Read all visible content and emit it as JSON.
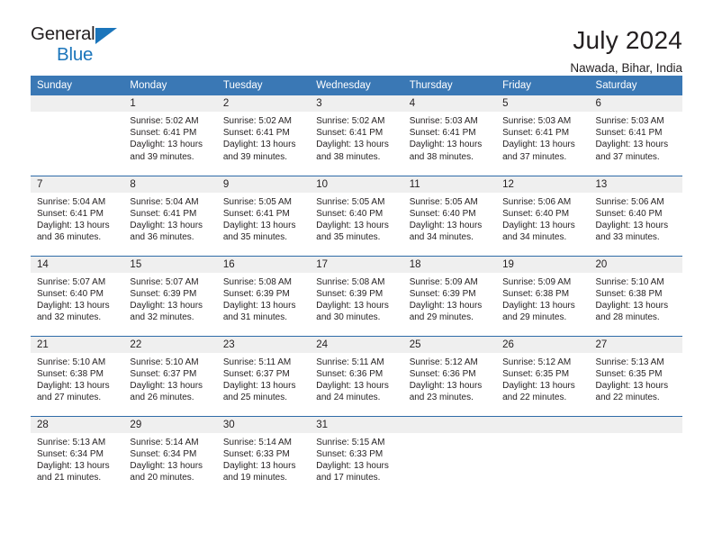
{
  "brand": {
    "name_part1": "General",
    "name_part2": "Blue"
  },
  "header": {
    "month_year": "July 2024",
    "location": "Nawada, Bihar, India"
  },
  "theme": {
    "header_blue": "#3a78b5",
    "rule_blue": "#2f6ca8",
    "daynum_gray": "#efefef",
    "logo_blue": "#1b75bb",
    "text_dark": "#231f20"
  },
  "weekday_headers": [
    "Sunday",
    "Monday",
    "Tuesday",
    "Wednesday",
    "Thursday",
    "Friday",
    "Saturday"
  ],
  "weeks": [
    [
      {
        "day": "",
        "blank": true,
        "sunrise": "",
        "sunset": "",
        "daylight_1": "",
        "daylight_2": ""
      },
      {
        "day": "1",
        "blank": false,
        "sunrise": "Sunrise: 5:02 AM",
        "sunset": "Sunset: 6:41 PM",
        "daylight_1": "Daylight: 13 hours",
        "daylight_2": "and 39 minutes."
      },
      {
        "day": "2",
        "blank": false,
        "sunrise": "Sunrise: 5:02 AM",
        "sunset": "Sunset: 6:41 PM",
        "daylight_1": "Daylight: 13 hours",
        "daylight_2": "and 39 minutes."
      },
      {
        "day": "3",
        "blank": false,
        "sunrise": "Sunrise: 5:02 AM",
        "sunset": "Sunset: 6:41 PM",
        "daylight_1": "Daylight: 13 hours",
        "daylight_2": "and 38 minutes."
      },
      {
        "day": "4",
        "blank": false,
        "sunrise": "Sunrise: 5:03 AM",
        "sunset": "Sunset: 6:41 PM",
        "daylight_1": "Daylight: 13 hours",
        "daylight_2": "and 38 minutes."
      },
      {
        "day": "5",
        "blank": false,
        "sunrise": "Sunrise: 5:03 AM",
        "sunset": "Sunset: 6:41 PM",
        "daylight_1": "Daylight: 13 hours",
        "daylight_2": "and 37 minutes."
      },
      {
        "day": "6",
        "blank": false,
        "sunrise": "Sunrise: 5:03 AM",
        "sunset": "Sunset: 6:41 PM",
        "daylight_1": "Daylight: 13 hours",
        "daylight_2": "and 37 minutes."
      }
    ],
    [
      {
        "day": "7",
        "blank": false,
        "sunrise": "Sunrise: 5:04 AM",
        "sunset": "Sunset: 6:41 PM",
        "daylight_1": "Daylight: 13 hours",
        "daylight_2": "and 36 minutes."
      },
      {
        "day": "8",
        "blank": false,
        "sunrise": "Sunrise: 5:04 AM",
        "sunset": "Sunset: 6:41 PM",
        "daylight_1": "Daylight: 13 hours",
        "daylight_2": "and 36 minutes."
      },
      {
        "day": "9",
        "blank": false,
        "sunrise": "Sunrise: 5:05 AM",
        "sunset": "Sunset: 6:41 PM",
        "daylight_1": "Daylight: 13 hours",
        "daylight_2": "and 35 minutes."
      },
      {
        "day": "10",
        "blank": false,
        "sunrise": "Sunrise: 5:05 AM",
        "sunset": "Sunset: 6:40 PM",
        "daylight_1": "Daylight: 13 hours",
        "daylight_2": "and 35 minutes."
      },
      {
        "day": "11",
        "blank": false,
        "sunrise": "Sunrise: 5:05 AM",
        "sunset": "Sunset: 6:40 PM",
        "daylight_1": "Daylight: 13 hours",
        "daylight_2": "and 34 minutes."
      },
      {
        "day": "12",
        "blank": false,
        "sunrise": "Sunrise: 5:06 AM",
        "sunset": "Sunset: 6:40 PM",
        "daylight_1": "Daylight: 13 hours",
        "daylight_2": "and 34 minutes."
      },
      {
        "day": "13",
        "blank": false,
        "sunrise": "Sunrise: 5:06 AM",
        "sunset": "Sunset: 6:40 PM",
        "daylight_1": "Daylight: 13 hours",
        "daylight_2": "and 33 minutes."
      }
    ],
    [
      {
        "day": "14",
        "blank": false,
        "sunrise": "Sunrise: 5:07 AM",
        "sunset": "Sunset: 6:40 PM",
        "daylight_1": "Daylight: 13 hours",
        "daylight_2": "and 32 minutes."
      },
      {
        "day": "15",
        "blank": false,
        "sunrise": "Sunrise: 5:07 AM",
        "sunset": "Sunset: 6:39 PM",
        "daylight_1": "Daylight: 13 hours",
        "daylight_2": "and 32 minutes."
      },
      {
        "day": "16",
        "blank": false,
        "sunrise": "Sunrise: 5:08 AM",
        "sunset": "Sunset: 6:39 PM",
        "daylight_1": "Daylight: 13 hours",
        "daylight_2": "and 31 minutes."
      },
      {
        "day": "17",
        "blank": false,
        "sunrise": "Sunrise: 5:08 AM",
        "sunset": "Sunset: 6:39 PM",
        "daylight_1": "Daylight: 13 hours",
        "daylight_2": "and 30 minutes."
      },
      {
        "day": "18",
        "blank": false,
        "sunrise": "Sunrise: 5:09 AM",
        "sunset": "Sunset: 6:39 PM",
        "daylight_1": "Daylight: 13 hours",
        "daylight_2": "and 29 minutes."
      },
      {
        "day": "19",
        "blank": false,
        "sunrise": "Sunrise: 5:09 AM",
        "sunset": "Sunset: 6:38 PM",
        "daylight_1": "Daylight: 13 hours",
        "daylight_2": "and 29 minutes."
      },
      {
        "day": "20",
        "blank": false,
        "sunrise": "Sunrise: 5:10 AM",
        "sunset": "Sunset: 6:38 PM",
        "daylight_1": "Daylight: 13 hours",
        "daylight_2": "and 28 minutes."
      }
    ],
    [
      {
        "day": "21",
        "blank": false,
        "sunrise": "Sunrise: 5:10 AM",
        "sunset": "Sunset: 6:38 PM",
        "daylight_1": "Daylight: 13 hours",
        "daylight_2": "and 27 minutes."
      },
      {
        "day": "22",
        "blank": false,
        "sunrise": "Sunrise: 5:10 AM",
        "sunset": "Sunset: 6:37 PM",
        "daylight_1": "Daylight: 13 hours",
        "daylight_2": "and 26 minutes."
      },
      {
        "day": "23",
        "blank": false,
        "sunrise": "Sunrise: 5:11 AM",
        "sunset": "Sunset: 6:37 PM",
        "daylight_1": "Daylight: 13 hours",
        "daylight_2": "and 25 minutes."
      },
      {
        "day": "24",
        "blank": false,
        "sunrise": "Sunrise: 5:11 AM",
        "sunset": "Sunset: 6:36 PM",
        "daylight_1": "Daylight: 13 hours",
        "daylight_2": "and 24 minutes."
      },
      {
        "day": "25",
        "blank": false,
        "sunrise": "Sunrise: 5:12 AM",
        "sunset": "Sunset: 6:36 PM",
        "daylight_1": "Daylight: 13 hours",
        "daylight_2": "and 23 minutes."
      },
      {
        "day": "26",
        "blank": false,
        "sunrise": "Sunrise: 5:12 AM",
        "sunset": "Sunset: 6:35 PM",
        "daylight_1": "Daylight: 13 hours",
        "daylight_2": "and 22 minutes."
      },
      {
        "day": "27",
        "blank": false,
        "sunrise": "Sunrise: 5:13 AM",
        "sunset": "Sunset: 6:35 PM",
        "daylight_1": "Daylight: 13 hours",
        "daylight_2": "and 22 minutes."
      }
    ],
    [
      {
        "day": "28",
        "blank": false,
        "sunrise": "Sunrise: 5:13 AM",
        "sunset": "Sunset: 6:34 PM",
        "daylight_1": "Daylight: 13 hours",
        "daylight_2": "and 21 minutes."
      },
      {
        "day": "29",
        "blank": false,
        "sunrise": "Sunrise: 5:14 AM",
        "sunset": "Sunset: 6:34 PM",
        "daylight_1": "Daylight: 13 hours",
        "daylight_2": "and 20 minutes."
      },
      {
        "day": "30",
        "blank": false,
        "sunrise": "Sunrise: 5:14 AM",
        "sunset": "Sunset: 6:33 PM",
        "daylight_1": "Daylight: 13 hours",
        "daylight_2": "and 19 minutes."
      },
      {
        "day": "31",
        "blank": false,
        "sunrise": "Sunrise: 5:15 AM",
        "sunset": "Sunset: 6:33 PM",
        "daylight_1": "Daylight: 13 hours",
        "daylight_2": "and 17 minutes."
      },
      {
        "day": "",
        "blank": true,
        "sunrise": "",
        "sunset": "",
        "daylight_1": "",
        "daylight_2": ""
      },
      {
        "day": "",
        "blank": true,
        "sunrise": "",
        "sunset": "",
        "daylight_1": "",
        "daylight_2": ""
      },
      {
        "day": "",
        "blank": true,
        "sunrise": "",
        "sunset": "",
        "daylight_1": "",
        "daylight_2": ""
      }
    ]
  ]
}
